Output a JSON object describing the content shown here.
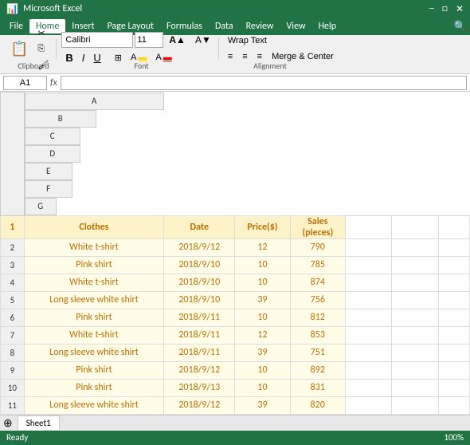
{
  "titleBar": {
    "title": "Microsoft Excel",
    "windowControls": [
      "minimize",
      "maximize",
      "close"
    ]
  },
  "menuBar": {
    "items": [
      "File",
      "Home",
      "Insert",
      "Page Layout",
      "Formulas",
      "Data",
      "Review",
      "View",
      "Help"
    ],
    "active": "Home"
  },
  "ribbon": {
    "clipboard": {
      "paste": "Paste"
    },
    "font": {
      "name": "Calibri",
      "size": "11",
      "bold": "B",
      "italic": "I",
      "underline": "U",
      "wrapText": "Wrap Text",
      "mergeCenter": "Merge & Center"
    },
    "groups": [
      "Clipboard",
      "Font",
      "Alignment"
    ],
    "clipboardLabel": "Clipboard",
    "fontLabel": "Font",
    "alignmentLabel": "Alignment"
  },
  "formulaBar": {
    "nameBox": "A1",
    "formula": ""
  },
  "columnHeaders": [
    "A",
    "B",
    "C",
    "D",
    "E",
    "F",
    "G"
  ],
  "tableHeader": {
    "col_a": "Clothes",
    "col_b": "Date",
    "col_c": "Price($)",
    "col_d": "Sales\n(pieces)"
  },
  "rows": [
    {
      "num": "2",
      "a": "White t-shirt",
      "b": "2018/9/12",
      "c": "12",
      "d": "790"
    },
    {
      "num": "3",
      "a": "Pink shirt",
      "b": "2018/9/10",
      "c": "10",
      "d": "785"
    },
    {
      "num": "4",
      "a": "White t-shirt",
      "b": "2018/9/10",
      "c": "10",
      "d": "874"
    },
    {
      "num": "5",
      "a": "Long sleeve white shirt",
      "b": "2018/9/10",
      "c": "39",
      "d": "756"
    },
    {
      "num": "6",
      "a": "Pink shirt",
      "b": "2018/9/11",
      "c": "10",
      "d": "812"
    },
    {
      "num": "7",
      "a": "White t-shirt",
      "b": "2018/9/11",
      "c": "12",
      "d": "853"
    },
    {
      "num": "8",
      "a": "Long sleeve white shirt",
      "b": "2018/9/11",
      "c": "39",
      "d": "751"
    },
    {
      "num": "9",
      "a": "Pink shirt",
      "b": "2018/9/12",
      "c": "10",
      "d": "892"
    },
    {
      "num": "10",
      "a": "Pink shirt",
      "b": "2018/9/13",
      "c": "10",
      "d": "831"
    },
    {
      "num": "11",
      "a": "Long sleeve white shirt",
      "b": "2018/9/12",
      "c": "39",
      "d": "820"
    }
  ],
  "sheetTab": "Sheet1",
  "statusBar": {
    "left": "Ready",
    "right": "100%"
  }
}
